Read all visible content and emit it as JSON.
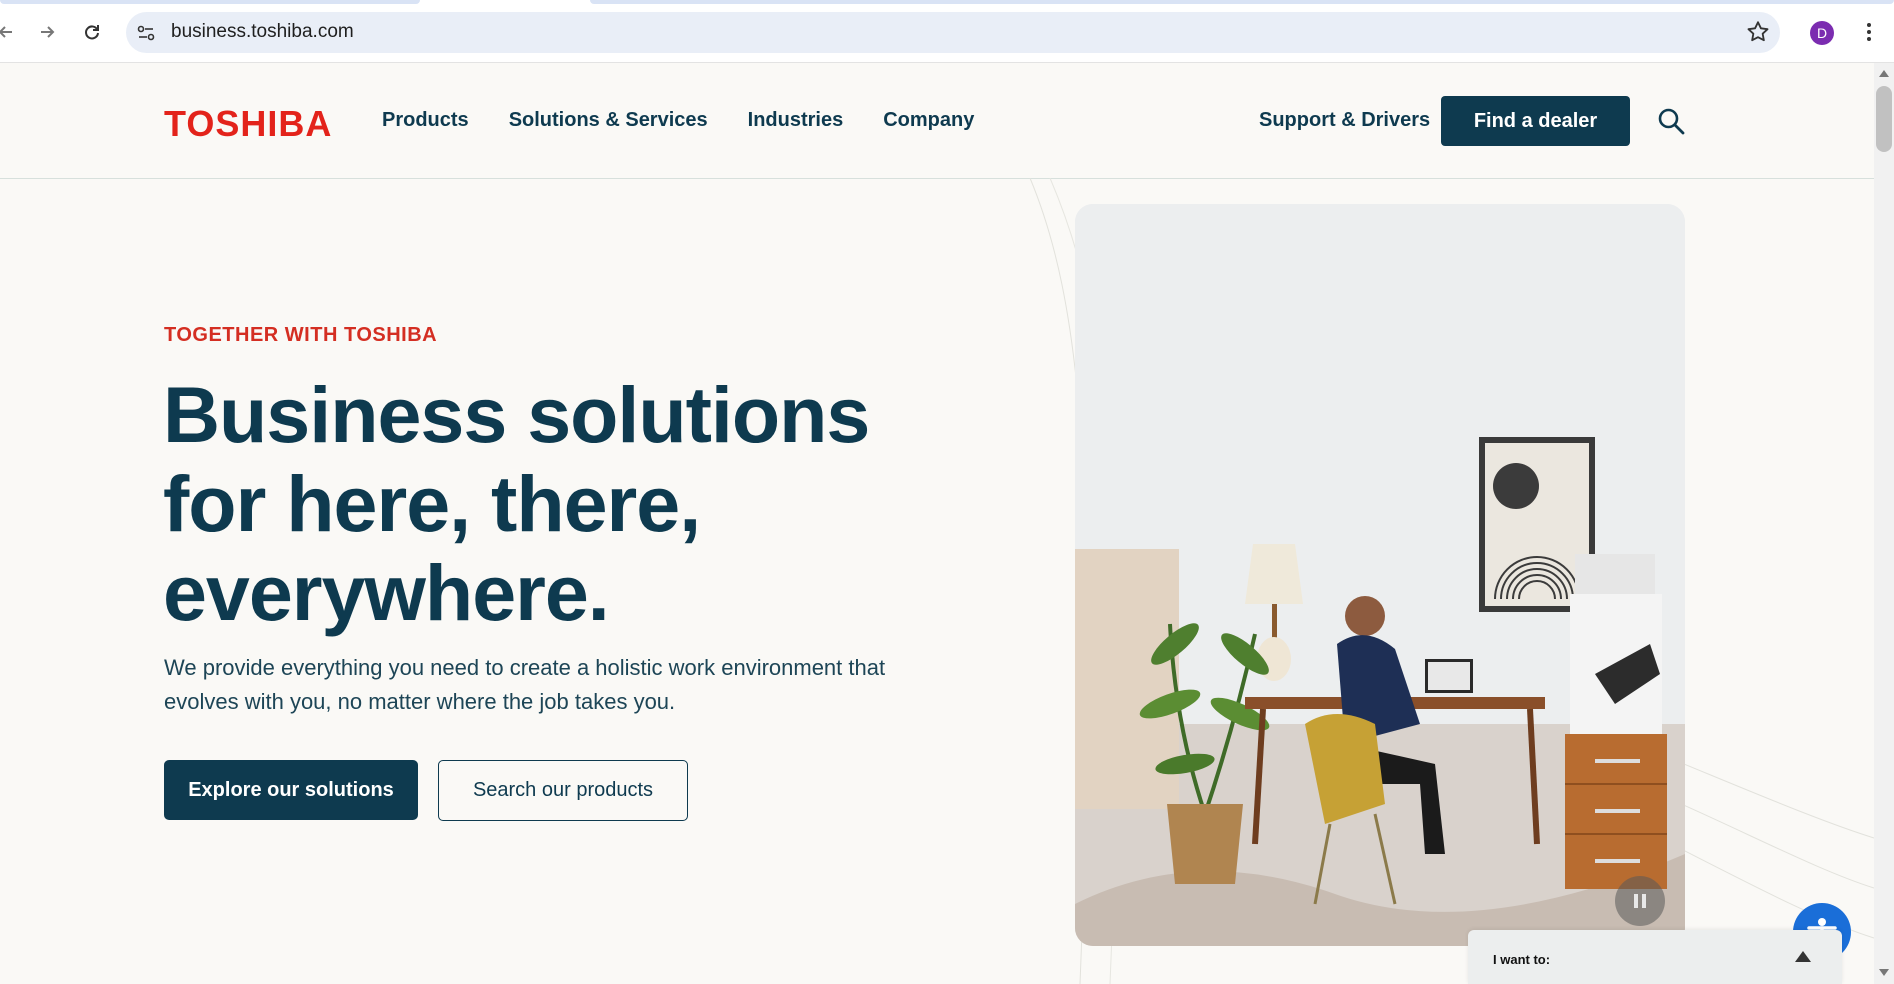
{
  "browser": {
    "url": "business.toshiba.com",
    "profile_initial": "D",
    "colors": {
      "avatar": "#7b2cb0",
      "address_bar": "#e9eef7"
    }
  },
  "header": {
    "logo": "TOSHIBA",
    "nav": [
      "Products",
      "Solutions & Services",
      "Industries",
      "Company"
    ],
    "support_label": "Support & Drivers",
    "dealer_label": "Find a dealer",
    "search_icon": "search-icon"
  },
  "hero": {
    "eyebrow": "TOGETHER WITH TOSHIBA",
    "title_lines": [
      "Business solutions",
      "for here, there,",
      "everywhere."
    ],
    "subtitle": "We provide everything you need to create a holistic work environment that evolves with you, no matter where the job takes you.",
    "primary_cta": "Explore our solutions",
    "secondary_cta": "Search our products",
    "image_description_icon": "office-photo",
    "pause_icon": "pause-icon"
  },
  "widgets": {
    "i_want_to_label": "I want to:",
    "accessibility_icon": "accessibility-icon"
  },
  "colors": {
    "brand_red": "#e3231b",
    "navy": "#0e3a4f",
    "background": "#faf9f6",
    "accessibility_blue": "#1a6ed8"
  }
}
